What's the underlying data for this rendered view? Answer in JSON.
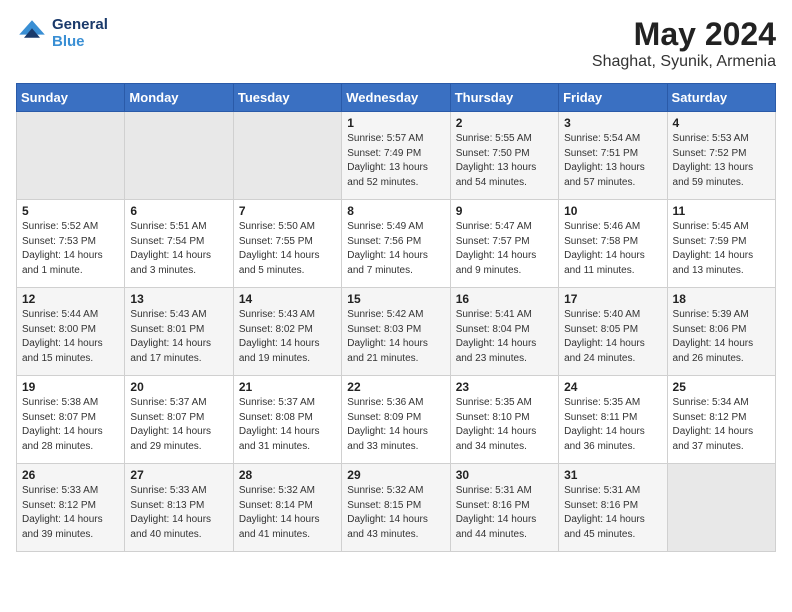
{
  "header": {
    "logo_line1": "General",
    "logo_line2": "Blue",
    "main_title": "May 2024",
    "subtitle": "Shaghat, Syunik, Armenia"
  },
  "days_of_week": [
    "Sunday",
    "Monday",
    "Tuesday",
    "Wednesday",
    "Thursday",
    "Friday",
    "Saturday"
  ],
  "weeks": [
    [
      {
        "day": "",
        "sunrise": "",
        "sunset": "",
        "daylight": ""
      },
      {
        "day": "",
        "sunrise": "",
        "sunset": "",
        "daylight": ""
      },
      {
        "day": "",
        "sunrise": "",
        "sunset": "",
        "daylight": ""
      },
      {
        "day": "1",
        "sunrise": "Sunrise: 5:57 AM",
        "sunset": "Sunset: 7:49 PM",
        "daylight": "Daylight: 13 hours and 52 minutes."
      },
      {
        "day": "2",
        "sunrise": "Sunrise: 5:55 AM",
        "sunset": "Sunset: 7:50 PM",
        "daylight": "Daylight: 13 hours and 54 minutes."
      },
      {
        "day": "3",
        "sunrise": "Sunrise: 5:54 AM",
        "sunset": "Sunset: 7:51 PM",
        "daylight": "Daylight: 13 hours and 57 minutes."
      },
      {
        "day": "4",
        "sunrise": "Sunrise: 5:53 AM",
        "sunset": "Sunset: 7:52 PM",
        "daylight": "Daylight: 13 hours and 59 minutes."
      }
    ],
    [
      {
        "day": "5",
        "sunrise": "Sunrise: 5:52 AM",
        "sunset": "Sunset: 7:53 PM",
        "daylight": "Daylight: 14 hours and 1 minute."
      },
      {
        "day": "6",
        "sunrise": "Sunrise: 5:51 AM",
        "sunset": "Sunset: 7:54 PM",
        "daylight": "Daylight: 14 hours and 3 minutes."
      },
      {
        "day": "7",
        "sunrise": "Sunrise: 5:50 AM",
        "sunset": "Sunset: 7:55 PM",
        "daylight": "Daylight: 14 hours and 5 minutes."
      },
      {
        "day": "8",
        "sunrise": "Sunrise: 5:49 AM",
        "sunset": "Sunset: 7:56 PM",
        "daylight": "Daylight: 14 hours and 7 minutes."
      },
      {
        "day": "9",
        "sunrise": "Sunrise: 5:47 AM",
        "sunset": "Sunset: 7:57 PM",
        "daylight": "Daylight: 14 hours and 9 minutes."
      },
      {
        "day": "10",
        "sunrise": "Sunrise: 5:46 AM",
        "sunset": "Sunset: 7:58 PM",
        "daylight": "Daylight: 14 hours and 11 minutes."
      },
      {
        "day": "11",
        "sunrise": "Sunrise: 5:45 AM",
        "sunset": "Sunset: 7:59 PM",
        "daylight": "Daylight: 14 hours and 13 minutes."
      }
    ],
    [
      {
        "day": "12",
        "sunrise": "Sunrise: 5:44 AM",
        "sunset": "Sunset: 8:00 PM",
        "daylight": "Daylight: 14 hours and 15 minutes."
      },
      {
        "day": "13",
        "sunrise": "Sunrise: 5:43 AM",
        "sunset": "Sunset: 8:01 PM",
        "daylight": "Daylight: 14 hours and 17 minutes."
      },
      {
        "day": "14",
        "sunrise": "Sunrise: 5:43 AM",
        "sunset": "Sunset: 8:02 PM",
        "daylight": "Daylight: 14 hours and 19 minutes."
      },
      {
        "day": "15",
        "sunrise": "Sunrise: 5:42 AM",
        "sunset": "Sunset: 8:03 PM",
        "daylight": "Daylight: 14 hours and 21 minutes."
      },
      {
        "day": "16",
        "sunrise": "Sunrise: 5:41 AM",
        "sunset": "Sunset: 8:04 PM",
        "daylight": "Daylight: 14 hours and 23 minutes."
      },
      {
        "day": "17",
        "sunrise": "Sunrise: 5:40 AM",
        "sunset": "Sunset: 8:05 PM",
        "daylight": "Daylight: 14 hours and 24 minutes."
      },
      {
        "day": "18",
        "sunrise": "Sunrise: 5:39 AM",
        "sunset": "Sunset: 8:06 PM",
        "daylight": "Daylight: 14 hours and 26 minutes."
      }
    ],
    [
      {
        "day": "19",
        "sunrise": "Sunrise: 5:38 AM",
        "sunset": "Sunset: 8:07 PM",
        "daylight": "Daylight: 14 hours and 28 minutes."
      },
      {
        "day": "20",
        "sunrise": "Sunrise: 5:37 AM",
        "sunset": "Sunset: 8:07 PM",
        "daylight": "Daylight: 14 hours and 29 minutes."
      },
      {
        "day": "21",
        "sunrise": "Sunrise: 5:37 AM",
        "sunset": "Sunset: 8:08 PM",
        "daylight": "Daylight: 14 hours and 31 minutes."
      },
      {
        "day": "22",
        "sunrise": "Sunrise: 5:36 AM",
        "sunset": "Sunset: 8:09 PM",
        "daylight": "Daylight: 14 hours and 33 minutes."
      },
      {
        "day": "23",
        "sunrise": "Sunrise: 5:35 AM",
        "sunset": "Sunset: 8:10 PM",
        "daylight": "Daylight: 14 hours and 34 minutes."
      },
      {
        "day": "24",
        "sunrise": "Sunrise: 5:35 AM",
        "sunset": "Sunset: 8:11 PM",
        "daylight": "Daylight: 14 hours and 36 minutes."
      },
      {
        "day": "25",
        "sunrise": "Sunrise: 5:34 AM",
        "sunset": "Sunset: 8:12 PM",
        "daylight": "Daylight: 14 hours and 37 minutes."
      }
    ],
    [
      {
        "day": "26",
        "sunrise": "Sunrise: 5:33 AM",
        "sunset": "Sunset: 8:12 PM",
        "daylight": "Daylight: 14 hours and 39 minutes."
      },
      {
        "day": "27",
        "sunrise": "Sunrise: 5:33 AM",
        "sunset": "Sunset: 8:13 PM",
        "daylight": "Daylight: 14 hours and 40 minutes."
      },
      {
        "day": "28",
        "sunrise": "Sunrise: 5:32 AM",
        "sunset": "Sunset: 8:14 PM",
        "daylight": "Daylight: 14 hours and 41 minutes."
      },
      {
        "day": "29",
        "sunrise": "Sunrise: 5:32 AM",
        "sunset": "Sunset: 8:15 PM",
        "daylight": "Daylight: 14 hours and 43 minutes."
      },
      {
        "day": "30",
        "sunrise": "Sunrise: 5:31 AM",
        "sunset": "Sunset: 8:16 PM",
        "daylight": "Daylight: 14 hours and 44 minutes."
      },
      {
        "day": "31",
        "sunrise": "Sunrise: 5:31 AM",
        "sunset": "Sunset: 8:16 PM",
        "daylight": "Daylight: 14 hours and 45 minutes."
      },
      {
        "day": "",
        "sunrise": "",
        "sunset": "",
        "daylight": ""
      }
    ]
  ]
}
